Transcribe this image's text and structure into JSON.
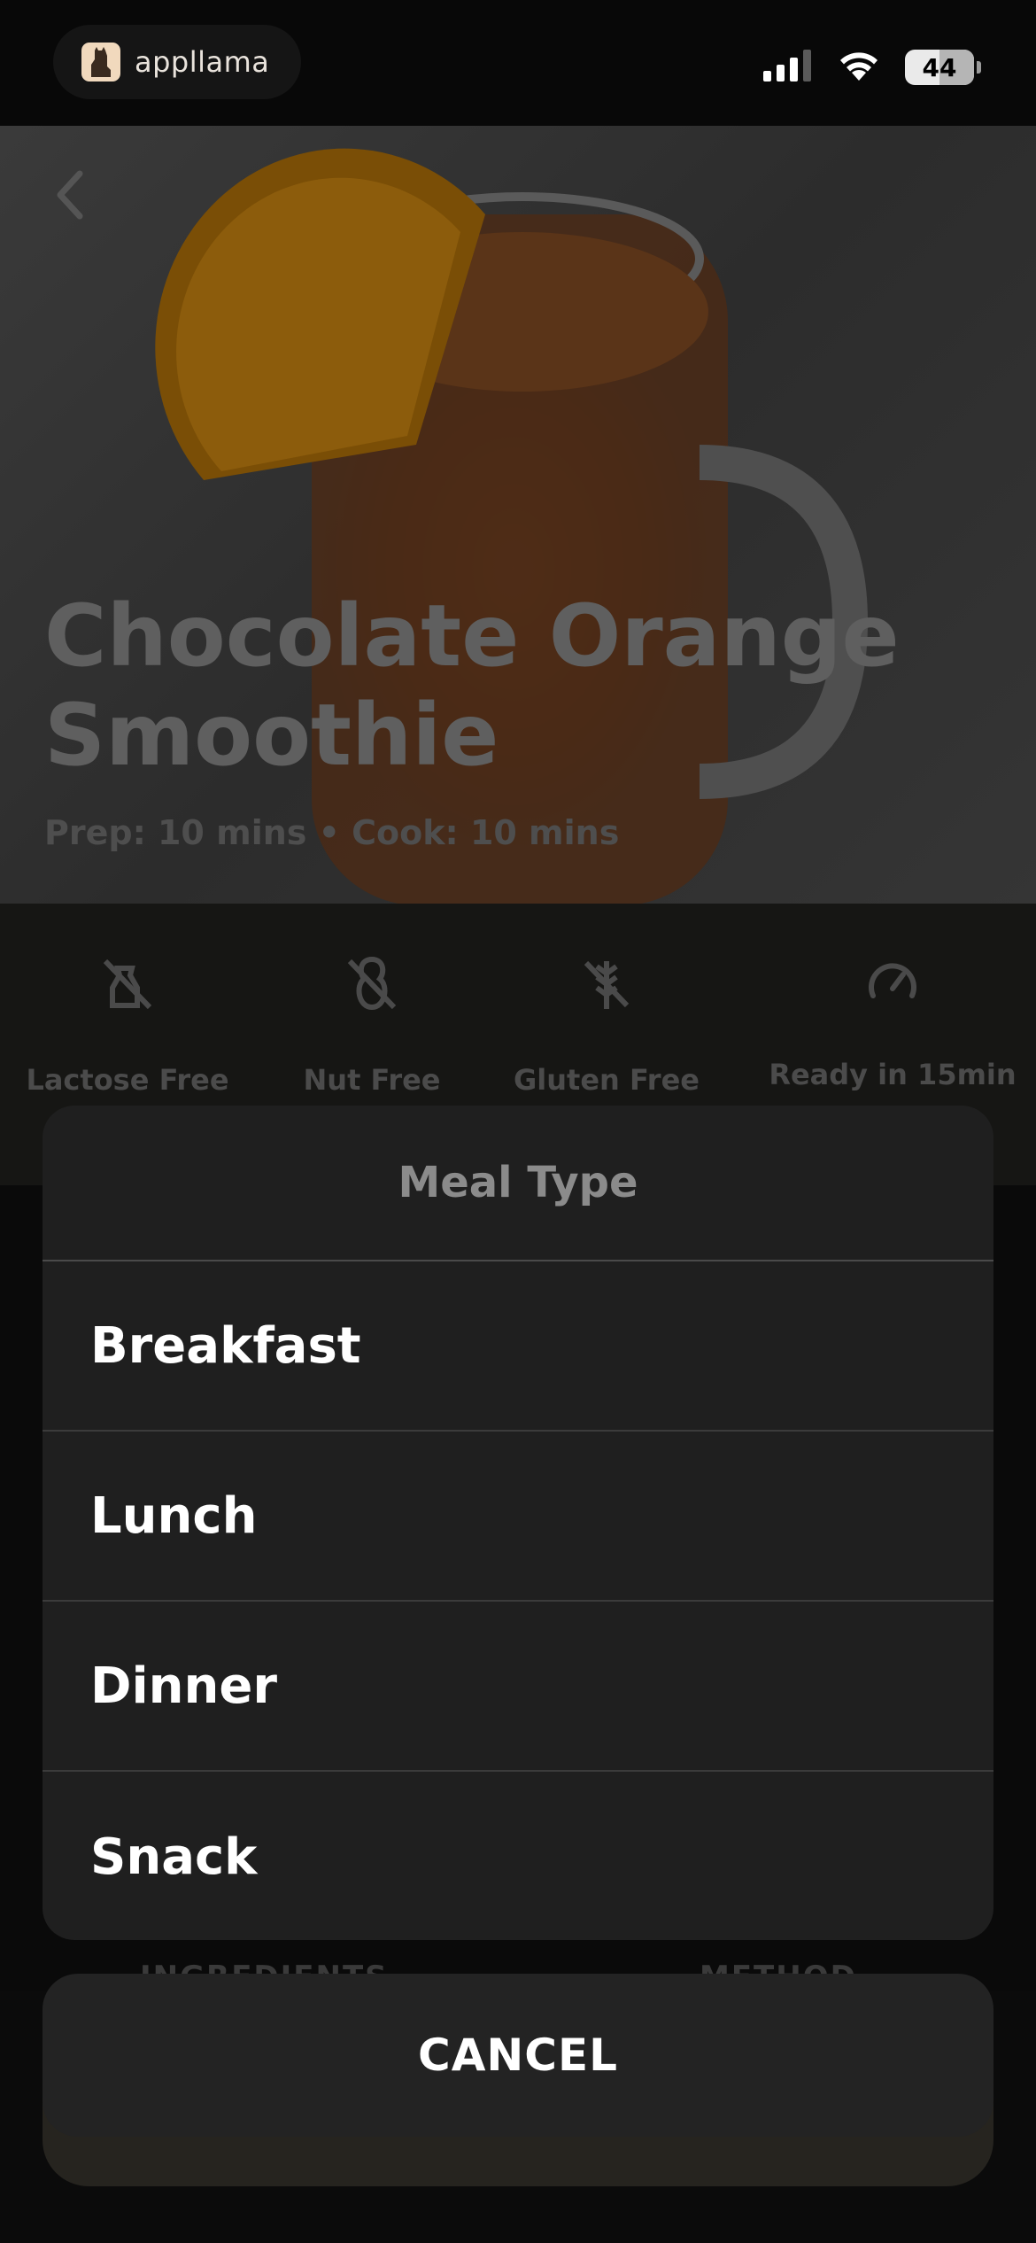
{
  "status_bar": {
    "brand_name": "appllama",
    "battery_level": "44"
  },
  "hero": {
    "title": "Chocolate Orange Smoothie",
    "times": "Prep: 10 mins • Cook: 10 mins"
  },
  "badges": [
    {
      "label": "Lactose Free",
      "icon": "no-dairy-icon"
    },
    {
      "label": "Nut Free",
      "icon": "no-nut-icon"
    },
    {
      "label": "Gluten Free",
      "icon": "no-gluten-icon"
    },
    {
      "label": "Ready in 15min",
      "icon": "speedometer-icon"
    }
  ],
  "tabs_peek": {
    "left": "INGREDIENTS",
    "right": "METHOD"
  },
  "action_sheet": {
    "title": "Meal Type",
    "options": [
      "Breakfast",
      "Lunch",
      "Dinner",
      "Snack"
    ],
    "cancel_label": "CANCEL"
  }
}
